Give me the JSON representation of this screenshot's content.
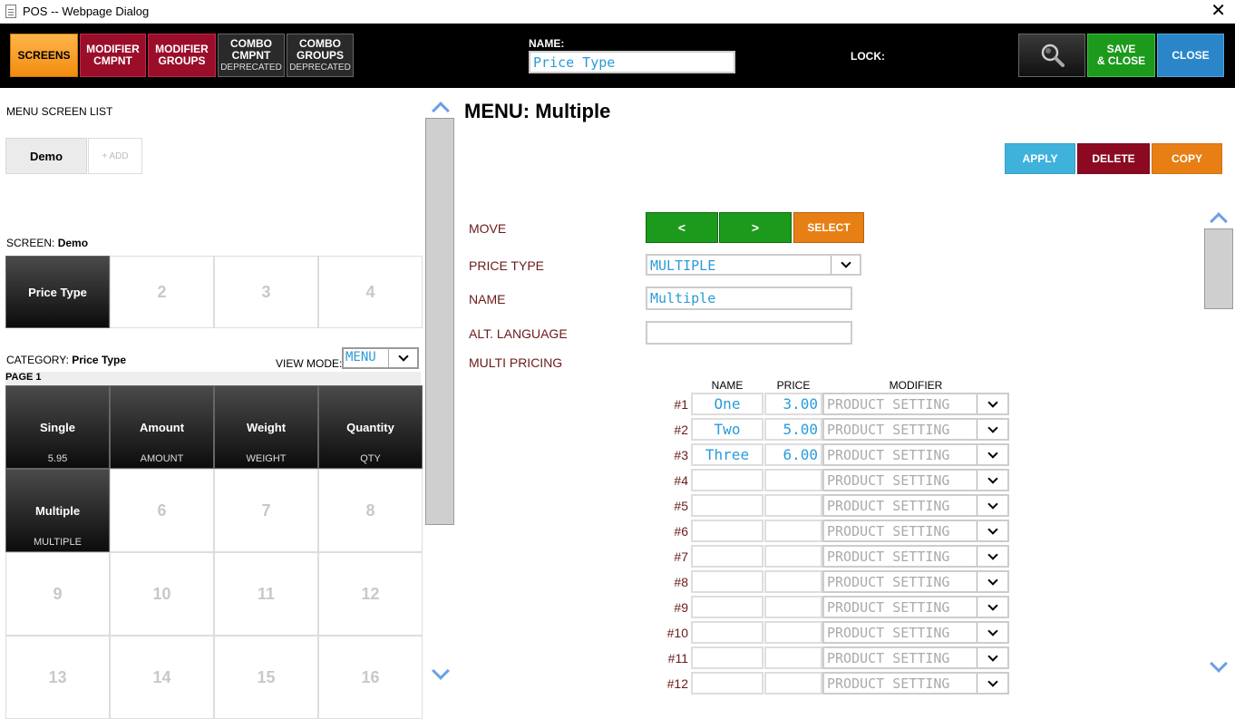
{
  "window": {
    "title": "POS -- Webpage Dialog",
    "close_glyph": "✕"
  },
  "toolbar": {
    "screens": "SCREENS",
    "modifier_cmpnt": [
      "MODIFIER",
      "CMPNT"
    ],
    "modifier_groups": [
      "MODIFIER",
      "GROUPS"
    ],
    "combo_cmpnt": [
      "COMBO",
      "CMPNT",
      "DEPRECATED"
    ],
    "combo_groups": [
      "COMBO",
      "GROUPS",
      "DEPRECATED"
    ],
    "name_label": "NAME:",
    "name_value": "Price Type",
    "lock_label": "LOCK:",
    "save_close": [
      "SAVE",
      "& CLOSE"
    ],
    "close": "CLOSE"
  },
  "left": {
    "menu_screen_list": "MENU SCREEN LIST",
    "tab_demo": "Demo",
    "tab_add": "+ ADD",
    "screen_label": "SCREEN:",
    "screen_name": "Demo",
    "screen_cells": [
      {
        "label": "Price Type",
        "sub": "",
        "active": true
      },
      {
        "label": "2",
        "sub": "",
        "active": false
      },
      {
        "label": "3",
        "sub": "",
        "active": false
      },
      {
        "label": "4",
        "sub": "",
        "active": false
      }
    ],
    "category_label": "CATEGORY:",
    "category_name": "Price Type",
    "view_mode_label": "VIEW MODE:",
    "view_mode_value": "MENU",
    "page_label": "PAGE 1",
    "menu_cells": [
      {
        "label": "Single",
        "sub": "5.95",
        "active": true
      },
      {
        "label": "Amount",
        "sub": "AMOUNT",
        "active": true
      },
      {
        "label": "Weight",
        "sub": "WEIGHT",
        "active": true
      },
      {
        "label": "Quantity",
        "sub": "QTY",
        "active": true
      },
      {
        "label": "Multiple",
        "sub": "MULTIPLE",
        "active": true
      },
      {
        "label": "6",
        "sub": "",
        "active": false
      },
      {
        "label": "7",
        "sub": "",
        "active": false
      },
      {
        "label": "8",
        "sub": "",
        "active": false
      },
      {
        "label": "9",
        "sub": "",
        "active": false
      },
      {
        "label": "10",
        "sub": "",
        "active": false
      },
      {
        "label": "11",
        "sub": "",
        "active": false
      },
      {
        "label": "12",
        "sub": "",
        "active": false
      },
      {
        "label": "13",
        "sub": "",
        "active": false
      },
      {
        "label": "14",
        "sub": "",
        "active": false
      },
      {
        "label": "15",
        "sub": "",
        "active": false
      },
      {
        "label": "16",
        "sub": "",
        "active": false
      }
    ]
  },
  "right": {
    "menu_title": "MENU: Multiple",
    "apply": "APPLY",
    "delete": "DELETE",
    "copy": "COPY",
    "move_label": "MOVE",
    "move_prev": "<",
    "move_next": ">",
    "select": "SELECT",
    "price_type_label": "PRICE TYPE",
    "price_type_value": "MULTIPLE",
    "name_label": "NAME",
    "name_value": "Multiple",
    "alt_language_label": "ALT. LANGUAGE",
    "alt_language_value": "",
    "multi_pricing_label": "MULTI PRICING",
    "col_name": "NAME",
    "col_price": "PRICE",
    "col_modifier": "MODIFIER",
    "rows": [
      {
        "num": "#1",
        "name": "One",
        "price": "3.00",
        "modifier": "PRODUCT SETTING"
      },
      {
        "num": "#2",
        "name": "Two",
        "price": "5.00",
        "modifier": "PRODUCT SETTING"
      },
      {
        "num": "#3",
        "name": "Three",
        "price": "6.00",
        "modifier": "PRODUCT SETTING"
      },
      {
        "num": "#4",
        "name": "",
        "price": "",
        "modifier": "PRODUCT SETTING"
      },
      {
        "num": "#5",
        "name": "",
        "price": "",
        "modifier": "PRODUCT SETTING"
      },
      {
        "num": "#6",
        "name": "",
        "price": "",
        "modifier": "PRODUCT SETTING"
      },
      {
        "num": "#7",
        "name": "",
        "price": "",
        "modifier": "PRODUCT SETTING"
      },
      {
        "num": "#8",
        "name": "",
        "price": "",
        "modifier": "PRODUCT SETTING"
      },
      {
        "num": "#9",
        "name": "",
        "price": "",
        "modifier": "PRODUCT SETTING"
      },
      {
        "num": "#10",
        "name": "",
        "price": "",
        "modifier": "PRODUCT SETTING"
      },
      {
        "num": "#11",
        "name": "",
        "price": "",
        "modifier": "PRODUCT SETTING"
      },
      {
        "num": "#12",
        "name": "",
        "price": "",
        "modifier": "PRODUCT SETTING"
      }
    ]
  },
  "colors": {
    "screens_orange": "#f28c0f",
    "modifier_red": "#9b0e2a",
    "save_green": "#1c9a1c",
    "close_blue": "#2a86c8",
    "apply_blue": "#3fb2dc",
    "delete_red": "#8b0a22",
    "copy_orange": "#e87f15",
    "field_text_blue": "#2a9bd8"
  }
}
